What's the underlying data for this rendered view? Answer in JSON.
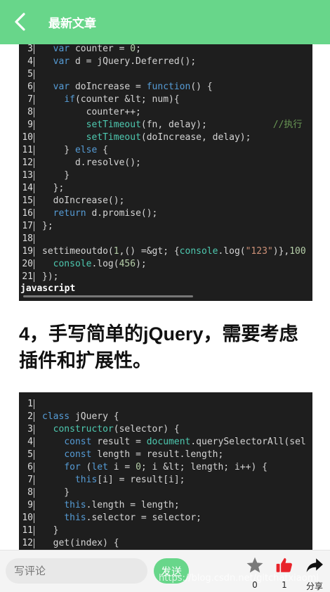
{
  "header": {
    "title": "最新文章",
    "back_icon": "chevron-left-icon"
  },
  "code1": {
    "lines": [
      {
        "n": "3",
        "t": [
          [
            "  ",
            ""
          ],
          [
            "var",
            "kw"
          ],
          [
            " counter = ",
            ""
          ],
          [
            "0",
            "num"
          ],
          [
            ";",
            ""
          ]
        ]
      },
      {
        "n": "4",
        "t": [
          [
            "  ",
            ""
          ],
          [
            "var",
            "kw"
          ],
          [
            " d = jQuery.Deferred();",
            ""
          ]
        ]
      },
      {
        "n": "5",
        "t": []
      },
      {
        "n": "6",
        "t": [
          [
            "  ",
            ""
          ],
          [
            "var",
            "kw"
          ],
          [
            " doIncrease = ",
            ""
          ],
          [
            "function",
            "kw"
          ],
          [
            "() {",
            ""
          ]
        ]
      },
      {
        "n": "7",
        "t": [
          [
            "    ",
            ""
          ],
          [
            "if",
            "kw"
          ],
          [
            "(counter &lt; num){",
            ""
          ]
        ]
      },
      {
        "n": "8",
        "t": [
          [
            "        counter++;",
            ""
          ]
        ]
      },
      {
        "n": "9",
        "t": [
          [
            "        ",
            ""
          ],
          [
            "setTimeout",
            "fn"
          ],
          [
            "(fn, delay);            ",
            ""
          ],
          [
            "//执行",
            "cm"
          ]
        ]
      },
      {
        "n": "10",
        "t": [
          [
            "        ",
            ""
          ],
          [
            "setTimeout",
            "fn"
          ],
          [
            "(doIncrease, delay);",
            ""
          ]
        ]
      },
      {
        "n": "11",
        "t": [
          [
            "    } ",
            ""
          ],
          [
            "else",
            "kw"
          ],
          [
            " {",
            ""
          ]
        ]
      },
      {
        "n": "12",
        "t": [
          [
            "      d.resolve();",
            ""
          ]
        ]
      },
      {
        "n": "13",
        "t": [
          [
            "    }",
            ""
          ]
        ]
      },
      {
        "n": "14",
        "t": [
          [
            "  };",
            ""
          ]
        ]
      },
      {
        "n": "15",
        "t": [
          [
            "  doIncrease();",
            ""
          ]
        ]
      },
      {
        "n": "16",
        "t": [
          [
            "  ",
            ""
          ],
          [
            "return",
            "kw"
          ],
          [
            " d.promise();",
            ""
          ]
        ]
      },
      {
        "n": "17",
        "t": [
          [
            "};",
            ""
          ]
        ]
      },
      {
        "n": "18",
        "t": []
      },
      {
        "n": "19",
        "t": [
          [
            "settimeoutdo(",
            ""
          ],
          [
            "1",
            "num"
          ],
          [
            ",() =&gt; {",
            ""
          ],
          [
            "console",
            "fn"
          ],
          [
            ".log(",
            ""
          ],
          [
            "\"123\"",
            "str"
          ],
          [
            ")},",
            ""
          ],
          [
            "100",
            "num"
          ]
        ]
      },
      {
        "n": "20",
        "t": [
          [
            "  ",
            ""
          ],
          [
            "console",
            "fn"
          ],
          [
            ".log(",
            ""
          ],
          [
            "456",
            "num"
          ],
          [
            ");",
            ""
          ]
        ]
      },
      {
        "n": "21",
        "t": [
          [
            "});",
            ""
          ]
        ]
      }
    ],
    "language": "javascript"
  },
  "section": {
    "heading": "4，手写简单的jQuery，需要考虑插件和扩展性。"
  },
  "code2": {
    "lines": [
      {
        "n": "1",
        "t": []
      },
      {
        "n": "2",
        "t": [
          [
            "class",
            "kw"
          ],
          [
            " jQuery {",
            ""
          ]
        ]
      },
      {
        "n": "3",
        "t": [
          [
            "  ",
            ""
          ],
          [
            "constructor",
            "fn"
          ],
          [
            "(selector) {",
            ""
          ]
        ]
      },
      {
        "n": "4",
        "t": [
          [
            "    ",
            ""
          ],
          [
            "const",
            "kw"
          ],
          [
            " result = ",
            ""
          ],
          [
            "document",
            "fn"
          ],
          [
            ".querySelectorAll(sel",
            ""
          ]
        ]
      },
      {
        "n": "5",
        "t": [
          [
            "    ",
            ""
          ],
          [
            "const",
            "kw"
          ],
          [
            " length = result.length;",
            ""
          ]
        ]
      },
      {
        "n": "6",
        "t": [
          [
            "    ",
            ""
          ],
          [
            "for",
            "kw"
          ],
          [
            " (",
            ""
          ],
          [
            "let",
            "kw"
          ],
          [
            " i = ",
            ""
          ],
          [
            "0",
            "num"
          ],
          [
            "; i &lt; length; i++) {",
            ""
          ]
        ]
      },
      {
        "n": "7",
        "t": [
          [
            "      ",
            ""
          ],
          [
            "this",
            "kw"
          ],
          [
            "[i] = result[i];",
            ""
          ]
        ]
      },
      {
        "n": "8",
        "t": [
          [
            "    }",
            ""
          ]
        ]
      },
      {
        "n": "9",
        "t": [
          [
            "    ",
            ""
          ],
          [
            "this",
            "kw"
          ],
          [
            ".length = length;",
            ""
          ]
        ]
      },
      {
        "n": "10",
        "t": [
          [
            "    ",
            ""
          ],
          [
            "this",
            "kw"
          ],
          [
            ".selector = selector;",
            ""
          ]
        ]
      },
      {
        "n": "11",
        "t": [
          [
            "  }",
            ""
          ]
        ]
      },
      {
        "n": "12",
        "t": [
          [
            "  get(index) {",
            ""
          ]
        ]
      }
    ]
  },
  "bottom": {
    "comment_placeholder": "写评论",
    "send_label": "发送",
    "star_count": "0",
    "like_count": "1",
    "share_label": "分享",
    "watermark": "https://blog.csdn.net/gitchatxiaomi",
    "star_icon": "star-icon",
    "like_icon": "thumbs-up-icon",
    "share_icon": "share-arrow-icon",
    "accent_color": "#68d68a",
    "like_color": "#e8232a"
  }
}
